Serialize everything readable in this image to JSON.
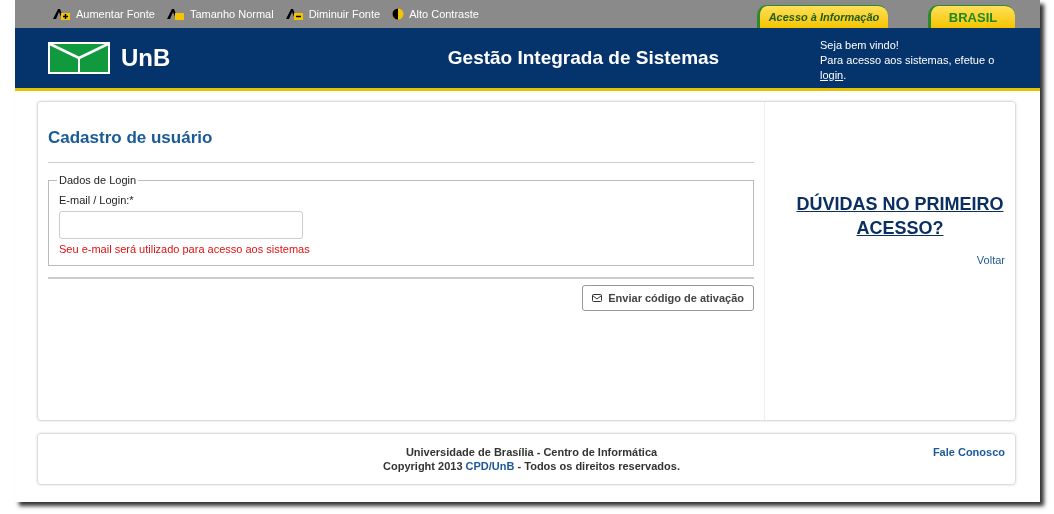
{
  "accessibility_bar": [
    {
      "kind": "increase",
      "label": "Aumentar Fonte"
    },
    {
      "kind": "normal",
      "label": "Tamanho Normal"
    },
    {
      "kind": "decrease",
      "label": "Diminuir Fonte"
    },
    {
      "kind": "contrast",
      "label": "Alto Contraste"
    }
  ],
  "gov_tabs": [
    {
      "label": "Acesso à Informação",
      "kind": "info"
    },
    {
      "label": "BRASIL",
      "kind": "brand"
    }
  ],
  "header": {
    "logo_text": "UnB",
    "title": "Gestão Integrada de Sistemas",
    "welcome": "Seja bem vindo!",
    "login_prompt": "Para acesso aos sistemas, efetue o",
    "login_link": "login",
    "login_end": "."
  },
  "form": {
    "title": "Cadastro de usuário",
    "fieldset_legend": "Dados de Login",
    "field_label": "E-mail / Login:*",
    "field_hint": "Seu e-mail será utilizado para acesso aos sistemas",
    "submit": "Enviar código de ativação"
  },
  "sidebar": {
    "help_link": "DÚVIDAS NO PRIMEIRO ACESSO?",
    "back_link": "Voltar"
  },
  "footer": {
    "line1": "Universidade de Brasília - Centro de Informática",
    "copyright_before": "Copyright 2013 ",
    "copyright_link": "CPD/UnB",
    "copyright_after": " - Todos os direitos reservados.",
    "contact_link": "Fale Conosco"
  }
}
